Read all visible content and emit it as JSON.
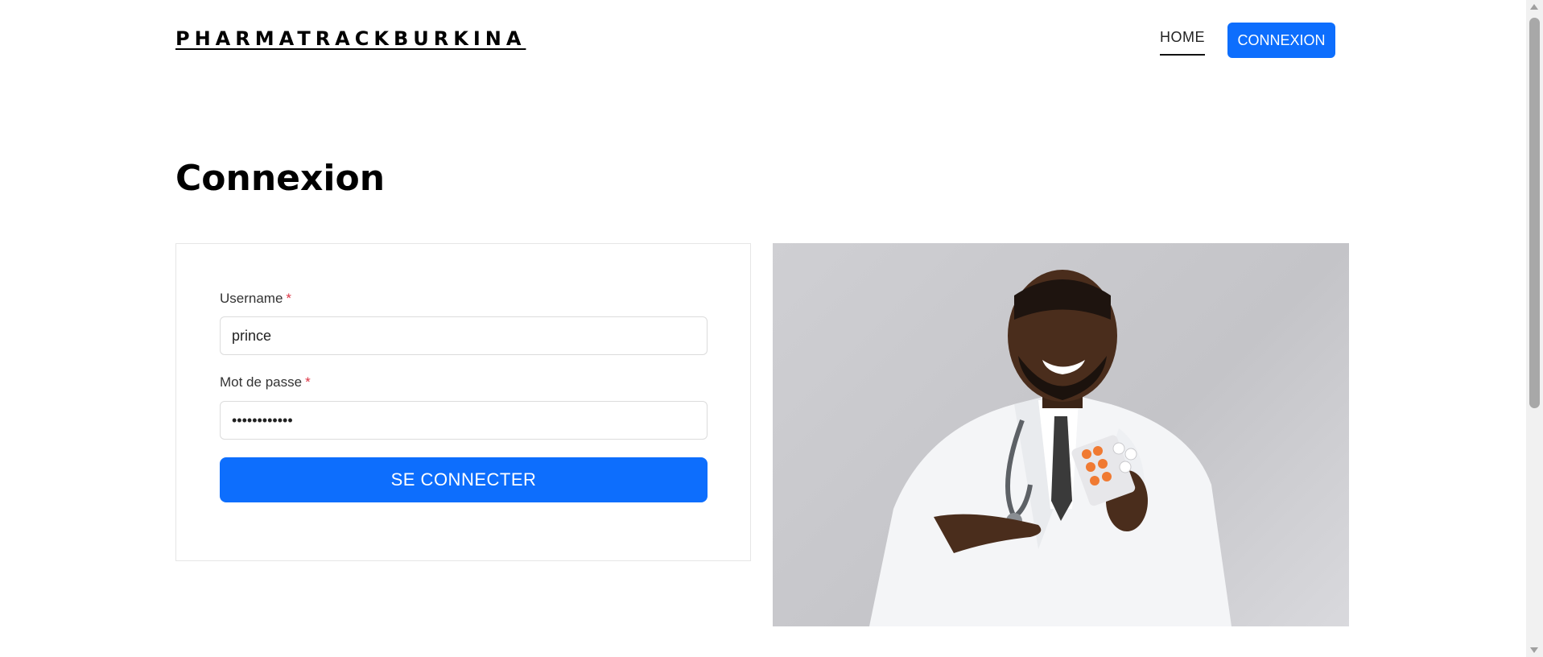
{
  "header": {
    "brand": "PHARMATRACKBURKINA",
    "nav_home": "HOME",
    "nav_connexion": "CONNEXION"
  },
  "page": {
    "title": "Connexion"
  },
  "form": {
    "username_label": "Username",
    "username_value": "prince",
    "password_label": "Mot de passe",
    "password_value": "princeprince",
    "required_mark": "*",
    "submit_label": "SE CONNECTER"
  },
  "photo": {
    "icon": "pharmacist-photo"
  },
  "colors": {
    "accent": "#0d6efd",
    "required": "#dc3545"
  }
}
